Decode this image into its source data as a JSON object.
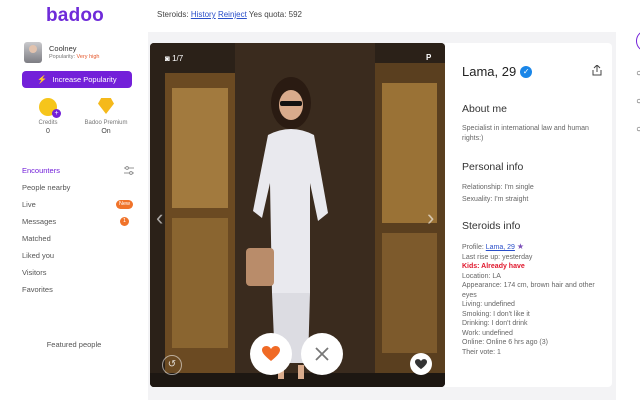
{
  "brand": {
    "logo": "badoo",
    "accent": "#7320d9"
  },
  "extension_bar": {
    "label": "Steroids:",
    "history": "History",
    "reinject": "Reinject",
    "quota": "Yes quota: 592"
  },
  "profile": {
    "name": "Coolney",
    "popularity_label": "Popularity:",
    "popularity_value": "Very high"
  },
  "increase_button": "Increase Popularity",
  "credits": {
    "label": "Credits",
    "value": "0",
    "icon": "coin-icon"
  },
  "premium": {
    "label": "Badoo Premium",
    "value": "On",
    "icon": "diamond-icon"
  },
  "nav": {
    "encounters": "Encounters",
    "people_nearby": "People nearby",
    "live": "Live",
    "live_badge": "New",
    "messages": "Messages",
    "messages_count": "1",
    "matched": "Matched",
    "liked_you": "Liked you",
    "visitors": "Visitors",
    "favorites": "Favorites"
  },
  "featured": "Featured people",
  "photo": {
    "counter": "1/7",
    "mark": "P"
  },
  "card": {
    "name_age": "Lama, 29",
    "about_title": "About me",
    "about_text": "Specialist in international law and human rights:)",
    "personal_title": "Personal info",
    "relationship": "Relationship: I'm single",
    "sexuality": "Sexuality: I'm straight",
    "steroids_title": "Steroids info",
    "profile_label": "Profile: ",
    "profile_link": "Lama, 29",
    "last_rise": "Last rise up: yesterday",
    "kids": "Kids: Already have",
    "location": "Location: LA",
    "appearance": "Appearance: 174 cm, brown hair and other eyes",
    "living": "Living: undefined",
    "smoking": "Smoking: I don't like it",
    "drinking": "Drinking: I don't drink",
    "work": "Work: undefined",
    "online": "Online: Online 6 hrs ago (3)",
    "vote": "Their vote: 1"
  }
}
